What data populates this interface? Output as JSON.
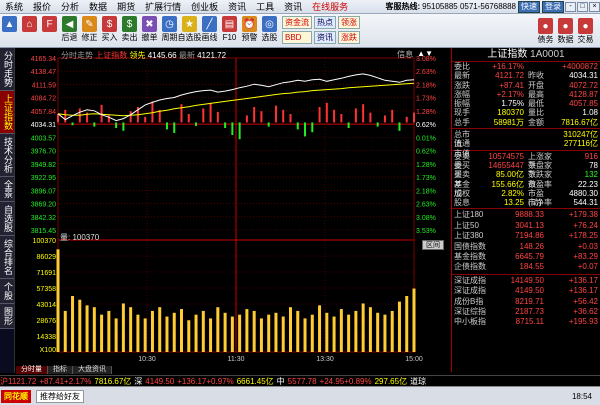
{
  "menubar": {
    "items": [
      "系统",
      "报价",
      "分析",
      "数据",
      "期货",
      "扩展行情",
      "创业板",
      "资讯",
      "工具",
      "资讯",
      "在线服务"
    ],
    "hotline_label": "客服热线:",
    "hotline": "95105885 0571-56768888",
    "btn_min": "-",
    "btn_max": "□",
    "btn_close": "×",
    "extra": [
      "快速",
      "登录"
    ]
  },
  "toolbar": {
    "buttons": [
      {
        "label": "",
        "icon": "arrow-up-icon"
      },
      {
        "label": "",
        "icon": "home-icon"
      },
      {
        "label": "",
        "icon": "f-icon"
      },
      {
        "label": "后退",
        "icon": "back-icon"
      },
      {
        "label": "修正",
        "icon": "edit-icon"
      },
      {
        "label": "买入",
        "icon": "buy-icon"
      },
      {
        "label": "卖出",
        "icon": "sell-icon"
      },
      {
        "label": "撤单",
        "icon": "cancel-icon"
      },
      {
        "label": "周期",
        "icon": "cycle-icon"
      },
      {
        "label": "自选股",
        "icon": "star-icon"
      },
      {
        "label": "画线",
        "icon": "draw-icon"
      },
      {
        "label": "F10",
        "icon": "f10-icon"
      },
      {
        "label": "预警",
        "icon": "alarm-icon"
      },
      {
        "label": "选股",
        "icon": "pick-icon"
      }
    ],
    "tags_a": [
      "资金流",
      "BBD"
    ],
    "tags_b": [
      "热点",
      "资讯"
    ],
    "tags_c": [
      "领涨",
      "涨跌"
    ],
    "right_btns": [
      {
        "label": "债务"
      },
      {
        "label": "数据"
      },
      {
        "label": "交易"
      }
    ]
  },
  "left_tabs": [
    "分时走势",
    "上证指数",
    "技术分析",
    "全景",
    "自选股",
    "综合排名",
    "个股",
    "图形"
  ],
  "chart": {
    "header_name": "分时走势",
    "header_index": "上证指数",
    "header_lead": "领先",
    "header_price1": "4145.66",
    "header_label2": "最新",
    "header_price2": "4121.72",
    "right_info": "信息",
    "right_arrows": "▲▼",
    "vol_label": "量: 100370",
    "zoom_btn": "区间"
  },
  "chart_data": {
    "type": "line",
    "price_axis": [
      "4165.34",
      "4138.47",
      "4111.59",
      "4084.72",
      "4057.84",
      "4034.31",
      "4003.57",
      "3976.70",
      "3949.82",
      "3922.95",
      "3896.07",
      "3869.20",
      "3842.32",
      "3815.45"
    ],
    "pct_axis": [
      "3.08%",
      "2.63%",
      "2.18%",
      "1.73%",
      "1.28%",
      "0.62%",
      "0.01%",
      "0.62%",
      "1.28%",
      "1.73%",
      "2.18%",
      "2.63%",
      "3.08%",
      "3.53%"
    ],
    "vol_axis": [
      "100370",
      "86029",
      "71691",
      "57358",
      "43014",
      "28676",
      "14338",
      "X100"
    ],
    "time_labels": [
      "10:30",
      "11:30",
      "13:30",
      "15:00"
    ],
    "prev_close": 4034.31,
    "price_series": [
      4052,
      4040,
      4048,
      4055,
      4060,
      4058,
      4050,
      4045,
      4038,
      4042,
      4050,
      4060,
      4070,
      4075,
      4080,
      4083,
      4085,
      4090,
      4094,
      4097,
      4099,
      4100,
      4096,
      4098,
      4101,
      4105,
      4108,
      4112,
      4110,
      4107,
      4111,
      4115,
      4117,
      4120,
      4118,
      4121,
      4122,
      4118,
      4121,
      4124,
      4128,
      4131,
      4133,
      4130,
      4125,
      4120,
      4118,
      4116,
      4120,
      4121
    ],
    "avg_series": [
      4052,
      4050,
      4049,
      4049,
      4051,
      4052,
      4051,
      4050,
      4049,
      4048,
      4049,
      4050,
      4052,
      4054,
      4057,
      4059,
      4062,
      4064,
      4066,
      4069,
      4071,
      4073,
      4075,
      4077,
      4079,
      4081,
      4083,
      4085,
      4087,
      4089,
      4091,
      4093,
      4094,
      4096,
      4097,
      4099,
      4100,
      4101,
      4102,
      4103,
      4105,
      4106,
      4107,
      4108,
      4109,
      4110,
      4111,
      4112,
      4113,
      4114
    ],
    "macd": [
      12,
      18,
      -4,
      20,
      14,
      -6,
      25,
      10,
      -8,
      -12,
      16,
      22,
      8,
      30,
      18,
      -10,
      -15,
      26,
      12,
      -5,
      20,
      28,
      15,
      -8,
      -18,
      -24,
      10,
      22,
      16,
      -6,
      24,
      18,
      12,
      -10,
      -20,
      -14,
      22,
      28,
      18,
      12,
      -8,
      20,
      26,
      14,
      -6,
      10,
      18,
      -12,
      8,
      14
    ],
    "volume": [
      55,
      22,
      30,
      28,
      25,
      24,
      20,
      22,
      18,
      26,
      24,
      20,
      18,
      22,
      24,
      19,
      21,
      23,
      17,
      20,
      22,
      18,
      24,
      21,
      19,
      20,
      23,
      22,
      18,
      20,
      21,
      19,
      24,
      22,
      18,
      20,
      25,
      21,
      19,
      23,
      20,
      22,
      26,
      24,
      21,
      20,
      22,
      27,
      30,
      34
    ],
    "xlim": [
      "09:30",
      "15:00"
    ]
  },
  "rpanel": {
    "title": "上证指数",
    "code": "1A0001",
    "rows": [
      {
        "k": "委比",
        "v": "+16.17%",
        "vc": "cr",
        "k2": "",
        "v2": "+4000872",
        "v2c": "cr"
      },
      {
        "k": "最新",
        "v": "4121.72",
        "vc": "cr",
        "k2": "昨收",
        "v2": "4034.31",
        "v2c": "cw"
      },
      {
        "k": "涨跌",
        "v": "+87.41",
        "vc": "cr",
        "k2": "开盘",
        "v2": "4072.72",
        "v2c": "cr"
      },
      {
        "k": "涨幅",
        "v": "+2.17%",
        "vc": "cr",
        "k2": "最高",
        "v2": "4128.87",
        "v2c": "cr"
      },
      {
        "k": "振幅",
        "v": "1.75%",
        "vc": "cw",
        "k2": "最低",
        "v2": "4057.85",
        "v2c": "cr"
      },
      {
        "k": "现手",
        "v": "180370",
        "vc": "cy",
        "k2": "量比",
        "v2": "1.08",
        "v2c": "cw"
      },
      {
        "k": "总手",
        "v": "58981万",
        "vc": "cy",
        "k2": "金额",
        "v2": "7816.67亿",
        "v2c": "cy"
      }
    ],
    "rows2": [
      {
        "k": "总市值",
        "v": "",
        "vc": "cw",
        "k2": "",
        "v2": "310247亿",
        "v2c": "cy"
      },
      {
        "k": "流通市值",
        "v": "",
        "vc": "cw",
        "k2": "",
        "v2": "277116亿",
        "v2c": "cy"
      }
    ],
    "rows3": [
      {
        "k": "委卖量",
        "v": "10574575",
        "vc": "cr",
        "k2": "上涨家数",
        "v2": "916",
        "v2c": "cr"
      },
      {
        "k": "委买量",
        "v": "14655447",
        "vc": "cr",
        "k2": "平盘家数",
        "v2": "78",
        "v2c": "cw"
      },
      {
        "k": "买卖差",
        "v": "85.00亿",
        "vc": "cy",
        "k2": "下跌家数",
        "v2": "132",
        "v2c": "cg"
      },
      {
        "k": "基金成",
        "v": "155.66亿",
        "vc": "cy",
        "k2": "市盈率",
        "v2": "22.23",
        "v2c": "cw"
      },
      {
        "k": "加权",
        "v": "2.82%",
        "vc": "cy",
        "k2": "市盈(动)",
        "v2": "4880.30",
        "v2c": "cw"
      },
      {
        "k": "股息",
        "v": "13.25",
        "vc": "cy",
        "k2": "市净率",
        "v2": "544.31",
        "v2c": "cw"
      }
    ],
    "indices_a": [
      {
        "n": "上证180",
        "p": "9888.33",
        "c": "+179.38"
      },
      {
        "n": "上证50",
        "p": "3041.13",
        "c": "+76.24"
      },
      {
        "n": "上证380",
        "p": "7194.86",
        "c": "+178.25"
      },
      {
        "n": "国债指数",
        "p": "148.26",
        "c": "+0.03"
      },
      {
        "n": "基金指数",
        "p": "6645.79",
        "c": "+83.29"
      },
      {
        "n": "企债指数",
        "p": "184.55",
        "c": "+0.07"
      }
    ],
    "indices_b": [
      {
        "n": "深证成指",
        "p": "14149.50",
        "c": "+136.17"
      },
      {
        "n": "深证成指",
        "p": "4149.50",
        "c": "+136.17"
      },
      {
        "n": "成份B指",
        "p": "8219.71",
        "c": "+56.42"
      },
      {
        "n": "深证综指",
        "p": "2187.73",
        "c": "+36.62"
      },
      {
        "n": "中小板指",
        "p": "8715.11",
        "c": "+195.93"
      }
    ]
  },
  "bottom_tabs": [
    "分时量",
    "指标",
    "大盘资讯"
  ],
  "status": {
    "items": [
      {
        "t": "沪1121.72",
        "c": "cr"
      },
      {
        "t": "+87.41+2.17%",
        "c": "cr"
      },
      {
        "t": "7816.67亿",
        "c": "cy"
      },
      {
        "t": "深",
        "c": "cw"
      },
      {
        "t": "4149.50",
        "c": "cr"
      },
      {
        "t": "+136.17+0.97%",
        "c": "cr"
      },
      {
        "t": "6661.45亿",
        "c": "cy"
      },
      {
        "t": "中",
        "c": "cw"
      },
      {
        "t": "5577.78",
        "c": "cr"
      },
      {
        "t": "+24.95+0.89%",
        "c": "cr"
      },
      {
        "t": "297.65亿",
        "c": "cy"
      },
      {
        "t": "道琼",
        "c": "cw"
      }
    ]
  },
  "status2": {
    "logo": "同花顺",
    "news": "推荐给好友",
    "time": "18:54"
  },
  "colors": {
    "up": "#ff3333",
    "down": "#22ee22",
    "price_line": "#ffffff",
    "avg_line": "#ffff00",
    "grid": "#800000"
  }
}
